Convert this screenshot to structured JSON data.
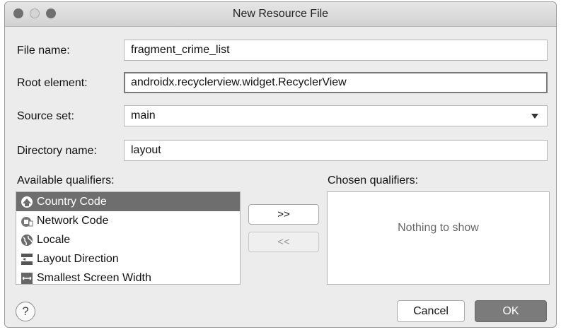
{
  "window": {
    "title": "New Resource File"
  },
  "form": {
    "file_name": {
      "label": "File name:",
      "value": "fragment_crime_list"
    },
    "root_element": {
      "label": "Root element:",
      "value": "androidx.recyclerview.widget.RecyclerView"
    },
    "source_set": {
      "label": "Source set:",
      "value": "main"
    },
    "directory_name": {
      "label": "Directory name:",
      "value": "layout"
    }
  },
  "available_qualifiers": {
    "label": "Available qualifiers:",
    "items": [
      {
        "label": "Country Code",
        "icon": "country-code-icon",
        "selected": true
      },
      {
        "label": "Network Code",
        "icon": "network-code-icon"
      },
      {
        "label": "Locale",
        "icon": "globe-icon"
      },
      {
        "label": "Layout Direction",
        "icon": "layout-direction-icon"
      },
      {
        "label": "Smallest Screen Width",
        "icon": "screen-width-icon"
      }
    ]
  },
  "chosen_qualifiers": {
    "label": "Chosen qualifiers:",
    "empty_text": "Nothing to show"
  },
  "buttons": {
    "add": ">>",
    "remove": "<<",
    "cancel": "Cancel",
    "ok": "OK",
    "help": "?"
  }
}
